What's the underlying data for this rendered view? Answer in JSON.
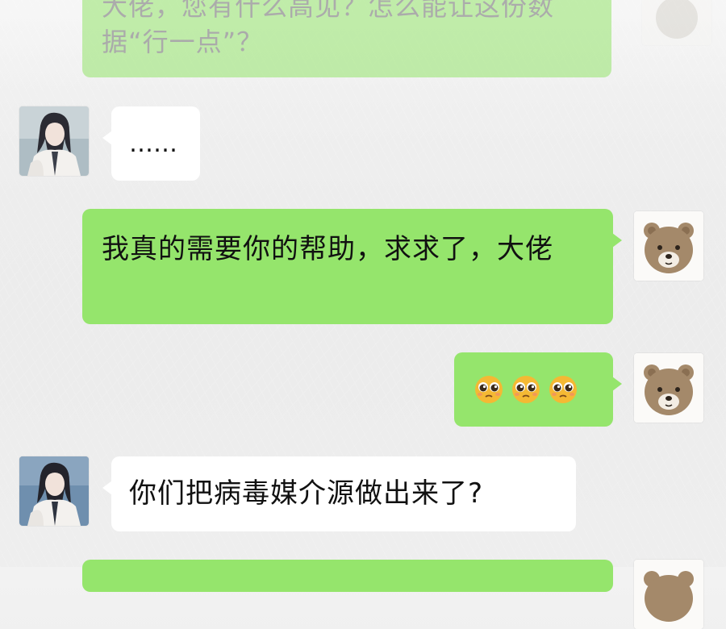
{
  "messages": [
    {
      "sender": "me",
      "style": "faded",
      "text": "大佬，您有什么高见？怎么能让这份数据“行一点”？"
    },
    {
      "sender": "contact",
      "text": "……"
    },
    {
      "sender": "me",
      "text": "我真的需要你的帮助，求求了，大佬"
    },
    {
      "sender": "me",
      "emojis": [
        "pleading-emoji",
        "pleading-emoji",
        "pleading-emoji"
      ]
    },
    {
      "sender": "contact",
      "text": "你们把病毒媒介源做出来了?"
    },
    {
      "sender": "me",
      "text": ""
    }
  ],
  "colors": {
    "my_bubble": "#95e56c",
    "contact_bubble": "#ffffff",
    "background": "#ededed"
  },
  "icons": {
    "my_avatar": "bear-avatar-icon",
    "contact_avatar": "girl-portrait-avatar-icon"
  }
}
